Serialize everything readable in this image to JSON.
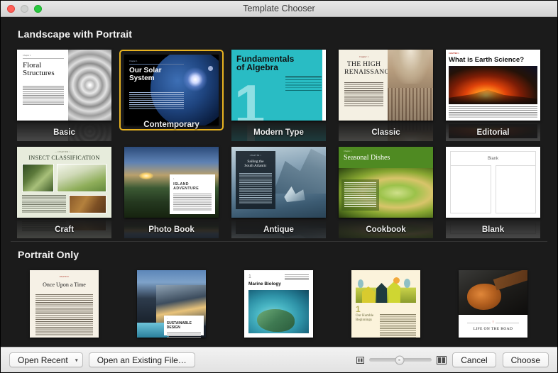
{
  "window": {
    "title": "Template Chooser",
    "traffic_lights": [
      {
        "name": "close",
        "color": "#ff5f57"
      },
      {
        "name": "minimize",
        "color": "#ced0ce"
      },
      {
        "name": "zoom",
        "color": "#28c840"
      }
    ]
  },
  "sections": [
    {
      "title": "Landscape with Portrait",
      "rows": [
        [
          {
            "label": "Basic",
            "selected": false,
            "art": "basic",
            "art_text": {
              "chapter": "Chapter 1",
              "heading": "Floral\nStructures"
            }
          },
          {
            "label": "Contemporary",
            "selected": true,
            "art": "contemporary",
            "art_text": {
              "chapter": "Chapter 1",
              "heading": "Our Solar\nSystem"
            }
          },
          {
            "label": "Modern Type",
            "selected": false,
            "art": "modern",
            "art_text": {
              "heading": "Fundamentals\nof Algebra",
              "number": "1"
            }
          },
          {
            "label": "Classic",
            "selected": false,
            "art": "classic",
            "art_text": {
              "chapter": "Chapter 1",
              "heading": "THE HIGH\nRENAISSANCE"
            }
          },
          {
            "label": "Editorial",
            "selected": false,
            "art": "editorial",
            "art_text": {
              "chapter": "CHAPTER 1",
              "heading": "What is Earth Science?"
            }
          }
        ],
        [
          {
            "label": "Craft",
            "selected": false,
            "art": "craft",
            "art_text": {
              "chapter": "— CHAPTER 1 —",
              "heading": "INSECT CLASSIFICATION"
            }
          },
          {
            "label": "Photo Book",
            "selected": false,
            "art": "photobook",
            "art_text": {
              "chapter": "1",
              "heading": "ISLAND\nADVENTURE"
            }
          },
          {
            "label": "Antique",
            "selected": false,
            "art": "antique",
            "art_text": {
              "chapter": "CHAPTER 1",
              "heading": "Sailing the\nSouth Atlantic"
            }
          },
          {
            "label": "Cookbook",
            "selected": false,
            "art": "cookbook",
            "art_text": {
              "chapter": "Chapter 1",
              "heading": "Seasonal Dishes"
            }
          },
          {
            "label": "Blank",
            "selected": false,
            "art": "blank",
            "art_text": {
              "heading": "Blank"
            }
          }
        ]
      ]
    },
    {
      "title": "Portrait Only",
      "rows": [
        [
          {
            "label": "",
            "selected": false,
            "art": "once",
            "art_text": {
              "chapter": "CHAPTER 1",
              "heading": "Once Upon a Time"
            }
          },
          {
            "label": "",
            "selected": false,
            "art": "sustainable",
            "art_text": {
              "chapter": "1",
              "heading": "SUSTAINABLE\nDESIGN"
            }
          },
          {
            "label": "",
            "selected": false,
            "art": "marine",
            "art_text": {
              "chapter": "1",
              "heading": "Marine Biology"
            }
          },
          {
            "label": "",
            "selected": false,
            "art": "village",
            "art_text": {
              "number": "1",
              "heading": "Our Humble\nBeginnings"
            }
          },
          {
            "label": "",
            "selected": false,
            "art": "guitar",
            "art_text": {
              "heading": "LIFE ON THE ROAD"
            }
          }
        ]
      ]
    }
  ],
  "toolbar": {
    "open_recent_label": "Open Recent",
    "open_recent_chevron": "chevron-down-icon",
    "open_existing_label": "Open an Existing File…",
    "slider": {
      "small_icon": "small-thumbnail-icon",
      "large_icon": "large-thumbnail-icon",
      "value": 48
    },
    "cancel_label": "Cancel",
    "choose_label": "Choose"
  },
  "colors": {
    "background": "#1b1b1b",
    "selection": "#e8b321",
    "titlebar": "#e3e3e3"
  }
}
